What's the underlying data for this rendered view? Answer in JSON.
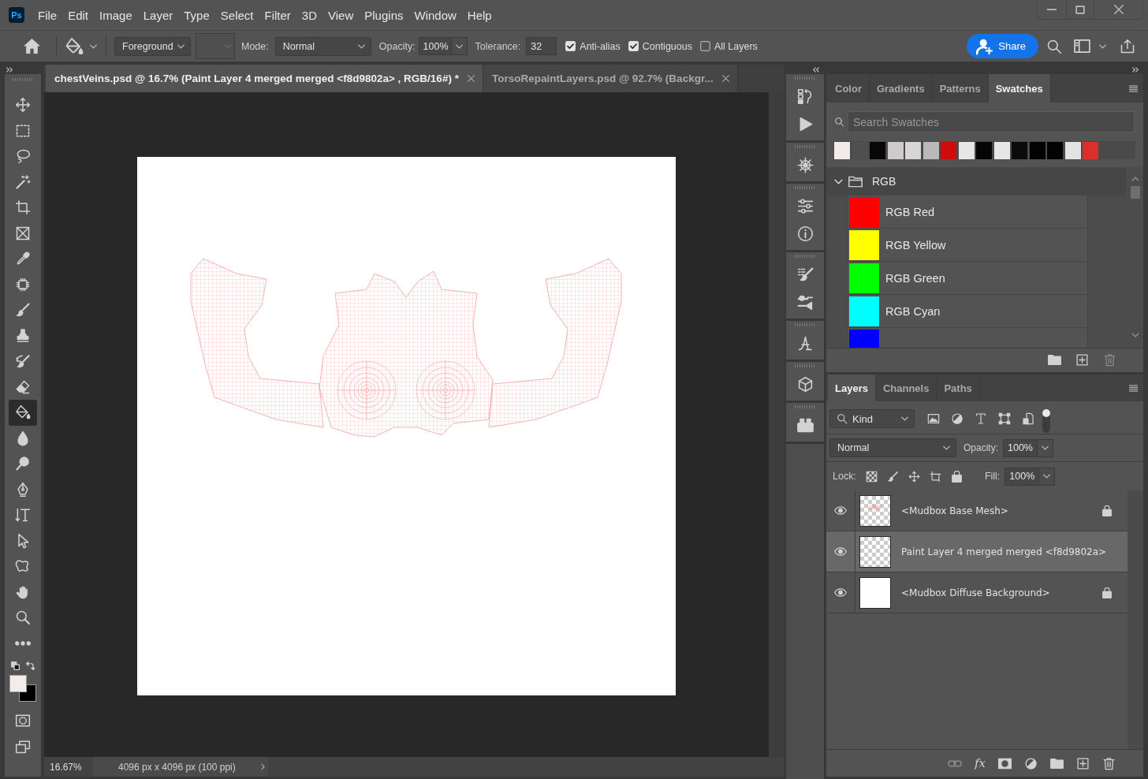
{
  "app_logo": "Ps",
  "menu": [
    {
      "label": "File"
    },
    {
      "label": "Edit"
    },
    {
      "label": "Image"
    },
    {
      "label": "Layer"
    },
    {
      "label": "Type"
    },
    {
      "label": "Select"
    },
    {
      "label": "Filter"
    },
    {
      "label": "3D"
    },
    {
      "label": "View"
    },
    {
      "label": "Plugins"
    },
    {
      "label": "Window"
    },
    {
      "label": "Help"
    }
  ],
  "options_bar": {
    "fill_source": "Foreground",
    "mode_label": "Mode:",
    "mode": "Normal",
    "opacity_label": "Opacity:",
    "opacity": "100%",
    "tolerance_label": "Tolerance:",
    "tolerance": "32",
    "checkboxes": [
      {
        "label": "Anti-alias",
        "checked": true
      },
      {
        "label": "Contiguous",
        "checked": true
      },
      {
        "label": "All Layers",
        "checked": false
      }
    ],
    "share_button": "Share"
  },
  "tools": [
    {
      "kind": "move",
      "selected": false
    },
    {
      "kind": "marquee",
      "selected": false
    },
    {
      "kind": "lasso",
      "selected": false
    },
    {
      "kind": "wand",
      "selected": false
    },
    {
      "kind": "crop",
      "selected": false
    },
    {
      "kind": "frame",
      "selected": false
    },
    {
      "kind": "eyedropper",
      "selected": false
    },
    {
      "kind": "chip",
      "selected": false
    },
    {
      "kind": "brush",
      "selected": false
    },
    {
      "kind": "stamp",
      "selected": false
    },
    {
      "kind": "history-brush",
      "selected": false
    },
    {
      "kind": "eraser",
      "selected": false
    },
    {
      "kind": "bucket",
      "selected": true
    },
    {
      "kind": "blur",
      "selected": false
    },
    {
      "kind": "dodge",
      "selected": false
    },
    {
      "kind": "pen",
      "selected": false
    },
    {
      "kind": "type",
      "selected": false
    },
    {
      "kind": "pointer",
      "selected": false
    },
    {
      "kind": "shape",
      "selected": false
    },
    {
      "kind": "hand",
      "selected": false
    },
    {
      "kind": "zoom",
      "selected": false
    },
    {
      "kind": "more",
      "selected": false
    }
  ],
  "color_swatches": [
    {
      "kind": "foreground",
      "color": "#f3ece8"
    },
    {
      "kind": "background",
      "color": "#000000"
    }
  ],
  "screen_tools": [
    {
      "kind": "quick-mask"
    },
    {
      "kind": "screen-mode"
    }
  ],
  "document_tabs": [
    {
      "title": "chestVeins.psd @ 16.7% (Paint Layer 4 merged merged <f8d9802a> , RGB/16#) *",
      "selected": true
    },
    {
      "title": "TorsoRepaintLayers.psd @ 92.7% (Backgr...",
      "selected": false
    }
  ],
  "status_bar": {
    "zoom": "16.67%",
    "document_info": "4096 px x 4096 px (100 ppi)"
  },
  "dock": [
    {
      "icons": [
        {
          "kind": "history"
        },
        {
          "kind": "play"
        }
      ]
    },
    {
      "icons": [
        {
          "kind": "wheel"
        }
      ]
    },
    {
      "icons": [
        {
          "kind": "sliders"
        },
        {
          "kind": "info"
        }
      ]
    },
    {
      "icons": [
        {
          "kind": "brush-list"
        },
        {
          "kind": "brush-settings"
        }
      ]
    },
    {
      "icons": [
        {
          "kind": "glyph"
        }
      ]
    },
    {
      "icons": [
        {
          "kind": "cube"
        }
      ]
    },
    {
      "icons": [
        {
          "kind": "toolbox"
        }
      ]
    }
  ],
  "swatches_panel": {
    "tabs": [
      {
        "label": "Color",
        "selected": false
      },
      {
        "label": "Gradients",
        "selected": false
      },
      {
        "label": "Patterns",
        "selected": false
      },
      {
        "label": "Swatches",
        "selected": true
      }
    ],
    "search": {
      "placeholder": "Search Swatches"
    },
    "recent_swatches": [
      {
        "color": "#f3ebe9"
      },
      {
        "color": "#4f4f4f"
      },
      {
        "color": "#070707"
      },
      {
        "color": "#cfcbcb"
      },
      {
        "color": "#d6d6d6"
      },
      {
        "color": "#b9b9b9"
      },
      {
        "color": "#d10b0b"
      },
      {
        "color": "#e6e6e6"
      },
      {
        "color": "#050505"
      },
      {
        "color": "#e6e6e6"
      },
      {
        "color": "#0b0b0b"
      },
      {
        "color": "#030303"
      },
      {
        "color": "#030303"
      },
      {
        "color": "#e3e3e3"
      },
      {
        "color": "#d92f2f"
      }
    ],
    "groups": [
      {
        "name": "RGB",
        "expanded": true,
        "swatches": [
          {
            "name": "RGB Red",
            "color": "#ff0000"
          },
          {
            "name": "RGB Yellow",
            "color": "#ffff00"
          },
          {
            "name": "RGB Green",
            "color": "#00ff00"
          },
          {
            "name": "RGB Cyan",
            "color": "#00ffff"
          },
          {
            "color": "#0000ff"
          }
        ]
      }
    ]
  },
  "layers_panel": {
    "tabs": [
      {
        "label": "Layers",
        "selected": true
      },
      {
        "label": "Channels",
        "selected": false
      },
      {
        "label": "Paths",
        "selected": false
      }
    ],
    "filter": {
      "label": "Kind",
      "on": true
    },
    "blend_mode": "Normal",
    "opacity_label": "Opacity:",
    "opacity": "100%",
    "lock_label": "Lock:",
    "fill_label": "Fill:",
    "fill": "100%",
    "layers": [
      {
        "name": "<Mudbox Base Mesh>",
        "visible": true,
        "locked": true,
        "selected": false,
        "kind": "mesh"
      },
      {
        "name": "Paint Layer 4 merged merged <f8d9802a>",
        "visible": true,
        "locked": false,
        "selected": true,
        "kind": "transparent"
      },
      {
        "name": "<Mudbox Diffuse Background>",
        "visible": true,
        "locked": true,
        "selected": false,
        "kind": "white"
      }
    ],
    "effects_button": "fx"
  }
}
